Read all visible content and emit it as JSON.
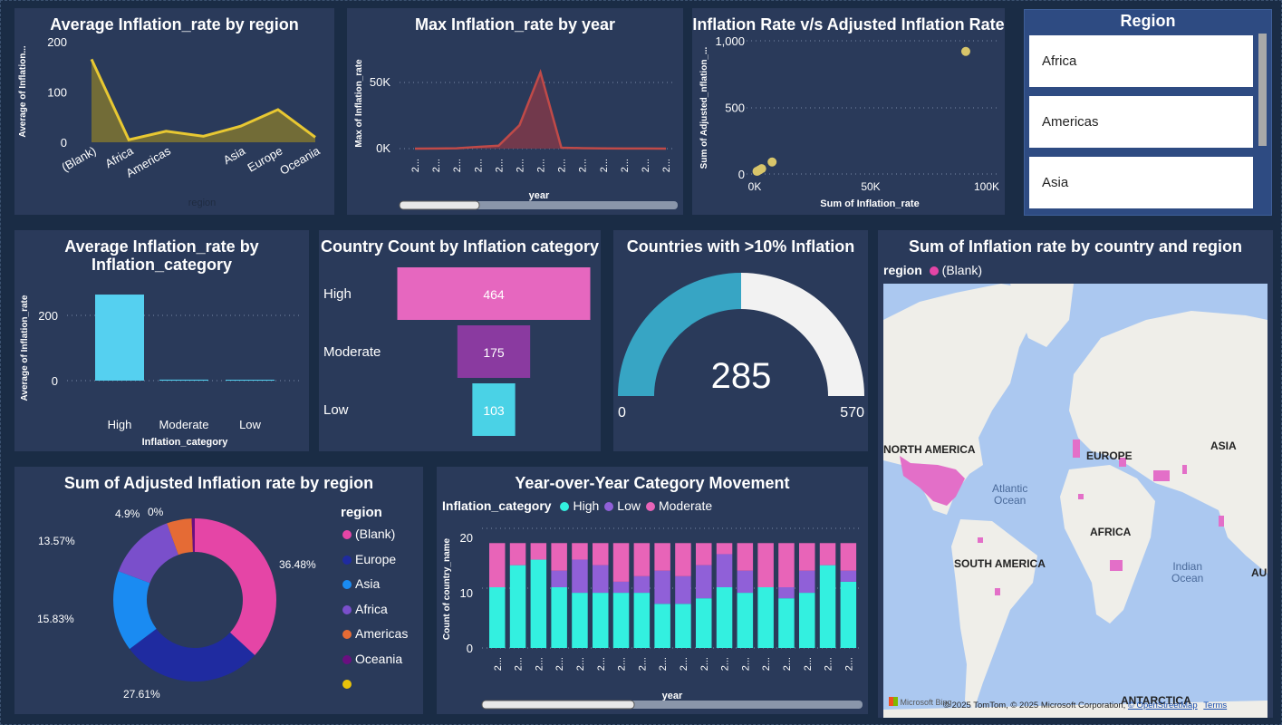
{
  "colors": {
    "background": "#1a2c45",
    "panel": "#2a3a5a",
    "yellow": "#e8c832",
    "red": "#c04a48",
    "pink": "#e060b8",
    "purple": "#8a3aa0",
    "cyan": "#48c8e8",
    "teal": "#37a5c4"
  },
  "panels": {
    "avg_region": {
      "title": "Average Inflation_rate by region",
      "ylabel": "Average of Inflation...",
      "xlabel": "region",
      "yticks": [
        "200",
        "100",
        "0"
      ],
      "chart_data": {
        "type": "area",
        "categories": [
          "(Blank)",
          "Africa",
          "Americas",
          "",
          "Asia",
          "Europe",
          "Oceania"
        ],
        "tick_labels": [
          "(Blank)",
          "Africa",
          "Americas",
          "Asia",
          "Europe",
          "Oceania"
        ],
        "values": [
          165,
          5,
          22,
          12,
          32,
          65,
          10
        ],
        "ylim": [
          0,
          200
        ]
      }
    },
    "max_year": {
      "title": "Max Inflation_rate by year",
      "ylabel": "Max of Inflation_rate",
      "xlabel": "year",
      "yticks": [
        "50K",
        "0K"
      ],
      "xtick_label": "2...",
      "chart_data": {
        "type": "area",
        "x_count": 13,
        "values": [
          0,
          100,
          300,
          1500,
          2500,
          20000,
          65000,
          800,
          400,
          200,
          100,
          50,
          0
        ],
        "ylim": [
          0,
          75000
        ]
      }
    },
    "scatter": {
      "title": "Inflation Rate v/s Adjusted Inflation Rate",
      "ylabel": "Sum of Adjusted_nflation_...",
      "xlabel": "Sum of Inflation_rate",
      "yticks": [
        "1,000",
        "500",
        "0"
      ],
      "xticks": [
        "0K",
        "50K",
        "100K"
      ],
      "chart_data": {
        "type": "scatter",
        "points": [
          [
            1000,
            20
          ],
          [
            2000,
            30
          ],
          [
            3000,
            40
          ],
          [
            7500,
            90
          ],
          [
            91000,
            920
          ]
        ],
        "xlim": [
          0,
          100000
        ],
        "ylim": [
          0,
          1000
        ]
      }
    },
    "slicer": {
      "title": "Region",
      "items": [
        "Africa",
        "Americas",
        "Asia"
      ]
    },
    "avg_cat": {
      "title_line1": "Average Inflation_rate by",
      "title_line2": "Inflation_category",
      "ylabel": "Average of Inflation_rate",
      "xlabel": "Inflation_category",
      "yticks": [
        "200",
        "0"
      ],
      "chart_data": {
        "type": "bar",
        "categories": [
          "High",
          "Moderate",
          "Low"
        ],
        "values": [
          265,
          3,
          1
        ],
        "ylim": [
          0,
          300
        ]
      }
    },
    "funnel": {
      "title": "Country Count by Inflation category",
      "chart_data": {
        "type": "bar",
        "categories": [
          "High",
          "Moderate",
          "Low"
        ],
        "values": [
          464,
          175,
          103
        ],
        "labels": [
          "464",
          "175",
          "103"
        ]
      }
    },
    "gauge": {
      "title": "Countries with >10% Inflation",
      "value_label": "285",
      "min_label": "0",
      "max_label": "570",
      "chart_data": {
        "type": "gauge",
        "value": 285,
        "min": 0,
        "max": 570
      }
    },
    "map": {
      "title": "Sum of Inflation rate by country and region",
      "legend_title": "region",
      "legend_item": "(Blank)",
      "labels": {
        "north_america": "NORTH AMERICA",
        "europe": "EUROPE",
        "asia": "ASIA",
        "africa": "AFRICA",
        "south_america": "SOUTH AMERICA",
        "antarctica": "ANTARCTICA",
        "aus": "AUS",
        "atlantic1": "Atlantic",
        "atlantic2": "Ocean",
        "indian1": "Indian",
        "indian2": "Ocean"
      },
      "bing": "Microsoft Bing",
      "copyright": "© 2025 TomTom, © 2025 Microsoft Corporation,",
      "osm": "© OpenStreetMap",
      "terms": "Terms"
    },
    "donut": {
      "title": "Sum of Adjusted Inflation rate by region",
      "legend_title": "region",
      "chart_data": {
        "type": "pie",
        "categories": [
          "(Blank)",
          "Europe",
          "Asia",
          "Africa",
          "Americas",
          "Oceania",
          ""
        ],
        "values": [
          36.48,
          27.61,
          15.83,
          13.57,
          4.9,
          0.6,
          0
        ],
        "labels": [
          "36.48%",
          "27.61%",
          "15.83%",
          "13.57%",
          "4.9%",
          "0%",
          ""
        ],
        "colors": [
          "#e545a6",
          "#1f2ba0",
          "#1a8bf2",
          "#7a4fcb",
          "#e56b35",
          "#6a0f80",
          "#e8c20a"
        ]
      }
    },
    "yoy": {
      "title": "Year-over-Year Category Movement",
      "legend_title": "Inflation_category",
      "ylabel": "Count of country_name",
      "xlabel": "year",
      "yticks": [
        "20",
        "10",
        "0"
      ],
      "xtick_label": "2...",
      "chart_data": {
        "type": "bar",
        "stacked": true,
        "series": [
          {
            "name": "High",
            "color": "#33f0e0",
            "values": [
              11,
              15,
              16,
              11,
              10,
              10,
              10,
              10,
              8,
              8,
              9,
              11,
              10,
              11,
              9,
              10,
              15,
              12
            ]
          },
          {
            "name": "Low",
            "color": "#9060d8",
            "values": [
              0,
              0,
              0,
              3,
              6,
              5,
              2,
              3,
              6,
              5,
              6,
              6,
              4,
              0,
              2,
              4,
              0,
              2
            ]
          },
          {
            "name": "Moderate",
            "color": "#e864b8",
            "values": [
              8,
              4,
              3,
              5,
              3,
              4,
              7,
              6,
              5,
              6,
              4,
              2,
              5,
              8,
              8,
              5,
              4,
              5
            ]
          }
        ],
        "ylim": [
          0,
          22
        ]
      }
    }
  }
}
